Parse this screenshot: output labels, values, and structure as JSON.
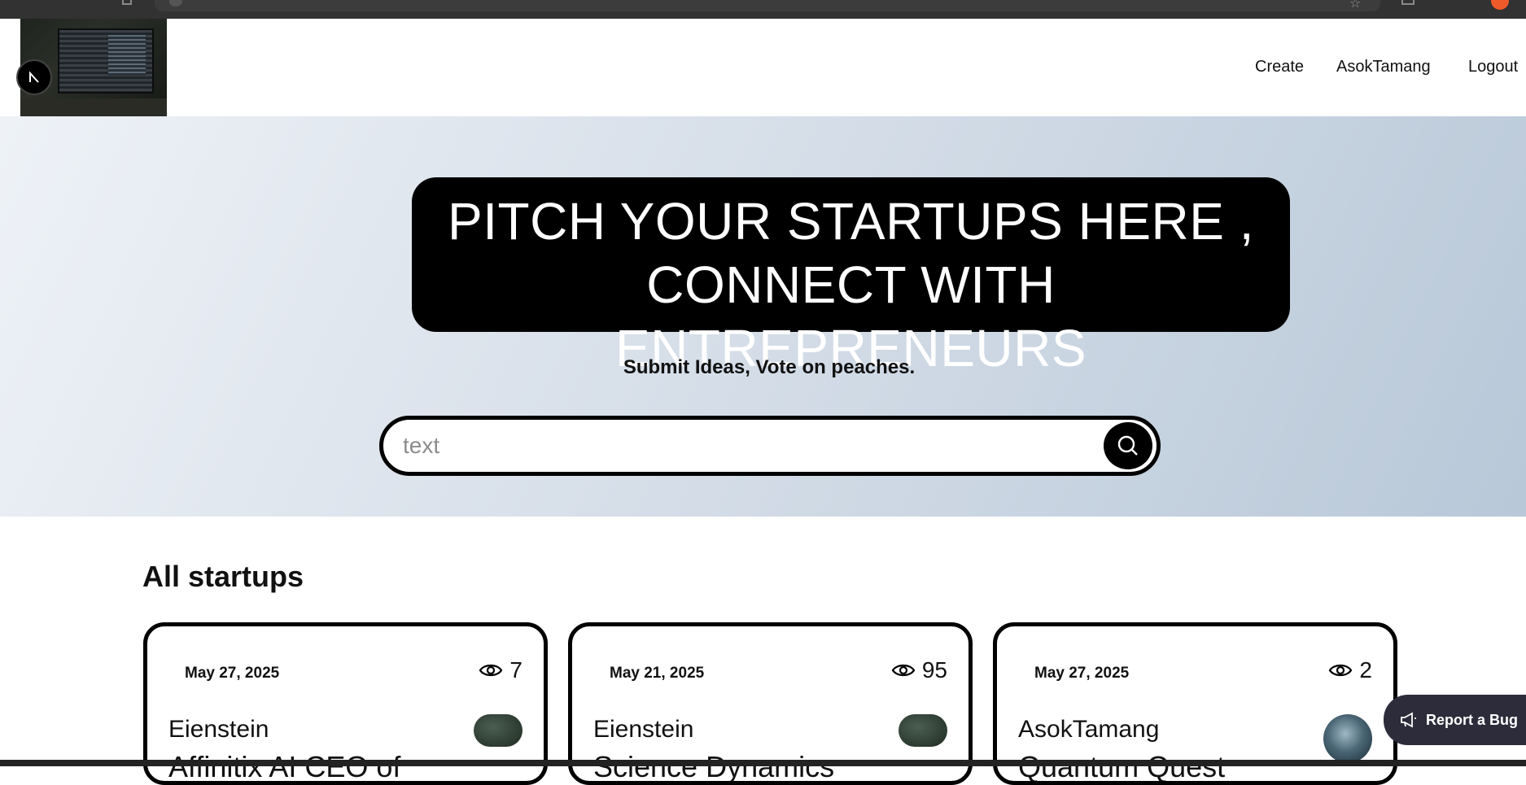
{
  "header": {
    "nav": {
      "create": "Create",
      "user": "AsokTamang",
      "logout": "Logout"
    }
  },
  "hero": {
    "title_line1": "PITCH YOUR STARTUPS HERE ,",
    "title_line2": "CONNECT WITH ENTREPRENEURS",
    "subtitle": "Submit Ideas, Vote on peaches.",
    "search_placeholder": "text"
  },
  "section": {
    "title": "All startups"
  },
  "cards": [
    {
      "date": "May 27, 2025",
      "views": "7",
      "author": "Eienstein",
      "title": "Affinitix AI CEO of"
    },
    {
      "date": "May 21, 2025",
      "views": "95",
      "author": "Eienstein",
      "title": "Science Dynamics"
    },
    {
      "date": "May 27, 2025",
      "views": "2",
      "author": "AsokTamang",
      "title": "Quantum Quest"
    }
  ],
  "report_bug": {
    "label": "Report a Bug"
  },
  "icons": {
    "search": "search-icon",
    "eye": "eye-icon",
    "megaphone": "megaphone-icon"
  },
  "colors": {
    "hero_title_bg": "#000000",
    "report_bug_bg": "#2d2c3a"
  }
}
